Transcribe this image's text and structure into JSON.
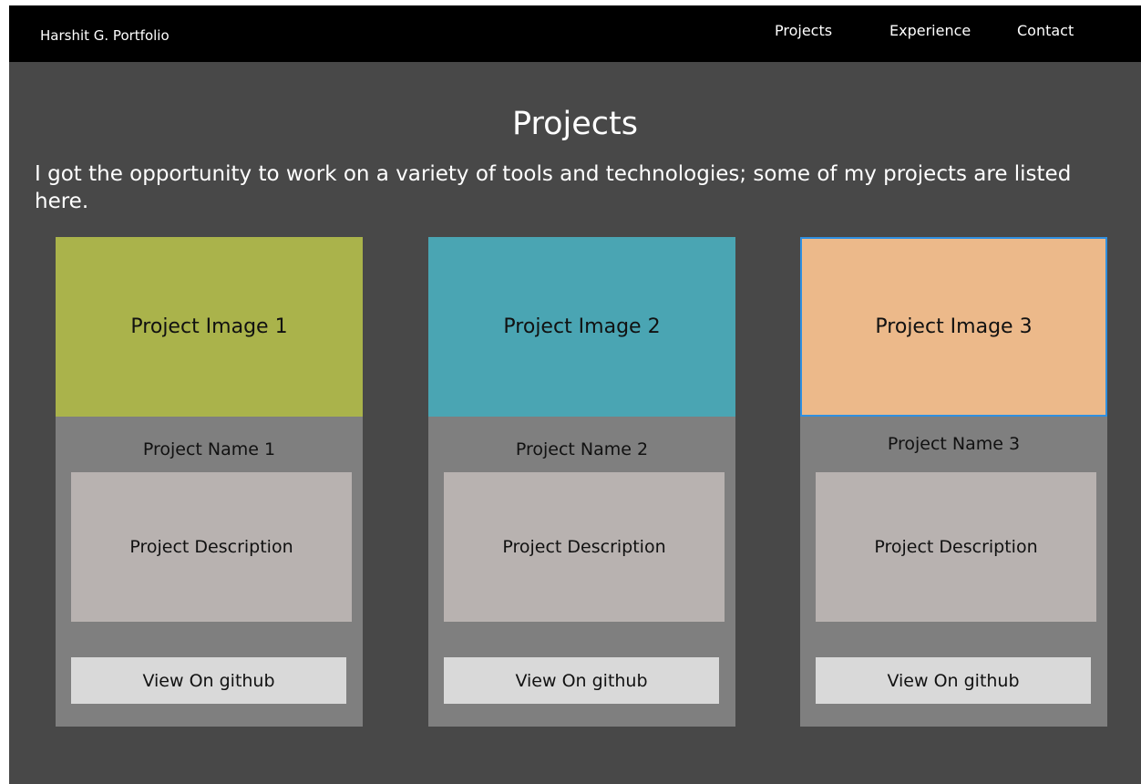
{
  "nav": {
    "brand": "Harshit G. Portfolio",
    "links": [
      "Projects",
      "Experience",
      "Contact"
    ]
  },
  "page": {
    "title": "Projects",
    "intro": "I got the opportunity to work on a variety of tools and technologies; some of my projects are listed here."
  },
  "projects": [
    {
      "image_label": "Project Image 1",
      "image_color": "#aab34b",
      "name": "Project Name 1",
      "description": "Project Description",
      "button": "View On github"
    },
    {
      "image_label": "Project Image 2",
      "image_color": "#4aa5b3",
      "name": "Project Name 2",
      "description": "Project Description",
      "button": "View On github"
    },
    {
      "image_label": "Project Image 3",
      "image_color": "#ecb98a",
      "name": "Project Name 3",
      "description": "Project Description",
      "button": "View On github"
    }
  ],
  "colors": {
    "background": "#484848",
    "navbar": "#000000",
    "card": "#7f7f7f",
    "description_box": "#b8b2b0",
    "button": "#d9d9d9",
    "selection_outline": "#2f8fe0"
  }
}
